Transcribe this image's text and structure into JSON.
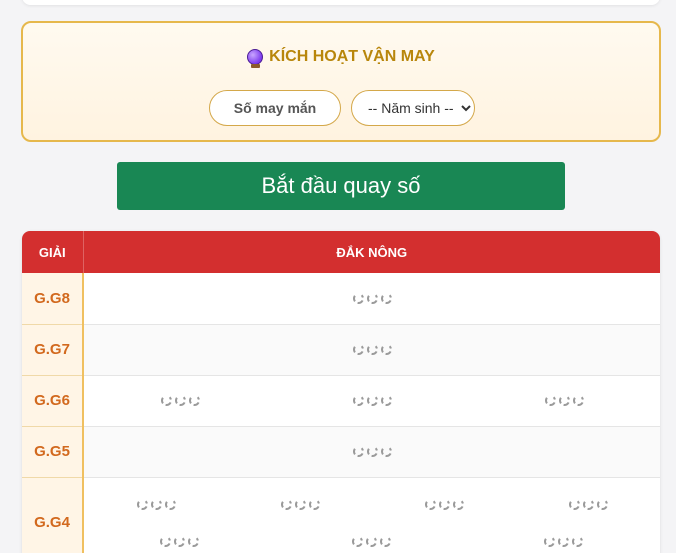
{
  "luck_panel": {
    "title": "KÍCH HOẠT VẬN MAY",
    "icon": "crystal-ball-icon",
    "lucky_number_placeholder": "Số may mắn",
    "year_select_value": "-- Năm sinh --"
  },
  "start_button_label": "Bắt đầu quay số",
  "results_table": {
    "header_col1": "GIẢI",
    "header_col2": "ĐẮK NÔNG",
    "rows": [
      {
        "prize": "G.G8",
        "count": 1
      },
      {
        "prize": "G.G7",
        "count": 1
      },
      {
        "prize": "G.G6",
        "count": 3
      },
      {
        "prize": "G.G5",
        "count": 1
      },
      {
        "prize": "G.G4",
        "count": 7
      }
    ]
  },
  "colors": {
    "header_red": "#d32f2f",
    "button_green": "#198754",
    "gold_border": "#e6b84c",
    "prize_text": "#d2691e"
  }
}
